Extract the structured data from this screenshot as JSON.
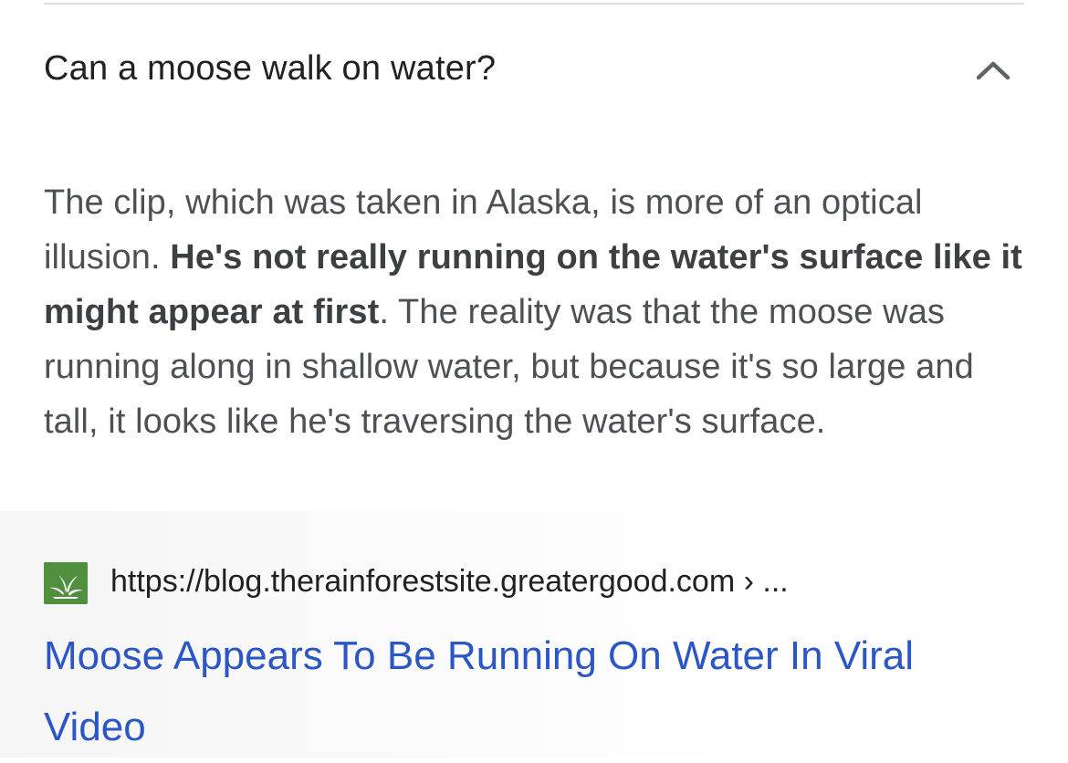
{
  "faq": {
    "question": "Can a moose walk on water?",
    "expanded": true,
    "toggle_icon": "chevron-up-icon"
  },
  "answer": {
    "text_before": "The clip, which was taken in Alaska, is more of an optical illusion. ",
    "text_bold": "He's not really running on the water's surface like it might appear at first",
    "text_after": ". The reality was that the moose was running along in shallow water, but because it's so large and tall, it looks like he's traversing the water's surface."
  },
  "source": {
    "favicon": "rainforest-leaf-icon",
    "url": "https://blog.therainforestsite.greatergood.com › ...",
    "title": "Moose Appears To Be Running On Water In Viral Video"
  },
  "colors": {
    "link": "#2a56c6",
    "question": "#202124",
    "body_text": "#4d5156",
    "favicon_bg": "#4f8f3e"
  }
}
